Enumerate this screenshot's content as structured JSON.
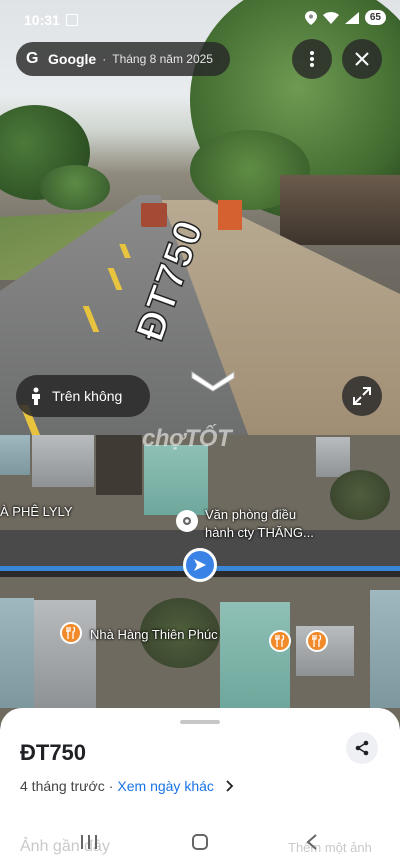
{
  "status_bar": {
    "time": "10:31",
    "battery": "65"
  },
  "header": {
    "brand": "Google",
    "separator": "·",
    "date": "Tháng 8 năm 2025"
  },
  "street_view": {
    "road_marking": "ĐT750",
    "aerial_button_label": "Trên không"
  },
  "map": {
    "watermark": "chợTỐT",
    "labels": {
      "cafe": "À PHÊ LYLY",
      "office_line1": "Văn phòng điều",
      "office_line2": "hành cty THĂNG...",
      "restaurant": "Nhà Hàng Thiên Phúc"
    }
  },
  "sheet": {
    "title": "ĐT750",
    "meta_age": "4 tháng trước",
    "meta_separator": "·",
    "meta_link": "Xem ngày khác",
    "ghost_left": "Ảnh gần đây",
    "ghost_right": "Thêm một ảnh"
  },
  "colors": {
    "accent_blue": "#3b82e6",
    "link_blue": "#1a73e8",
    "poi_orange": "#f08a2b"
  }
}
